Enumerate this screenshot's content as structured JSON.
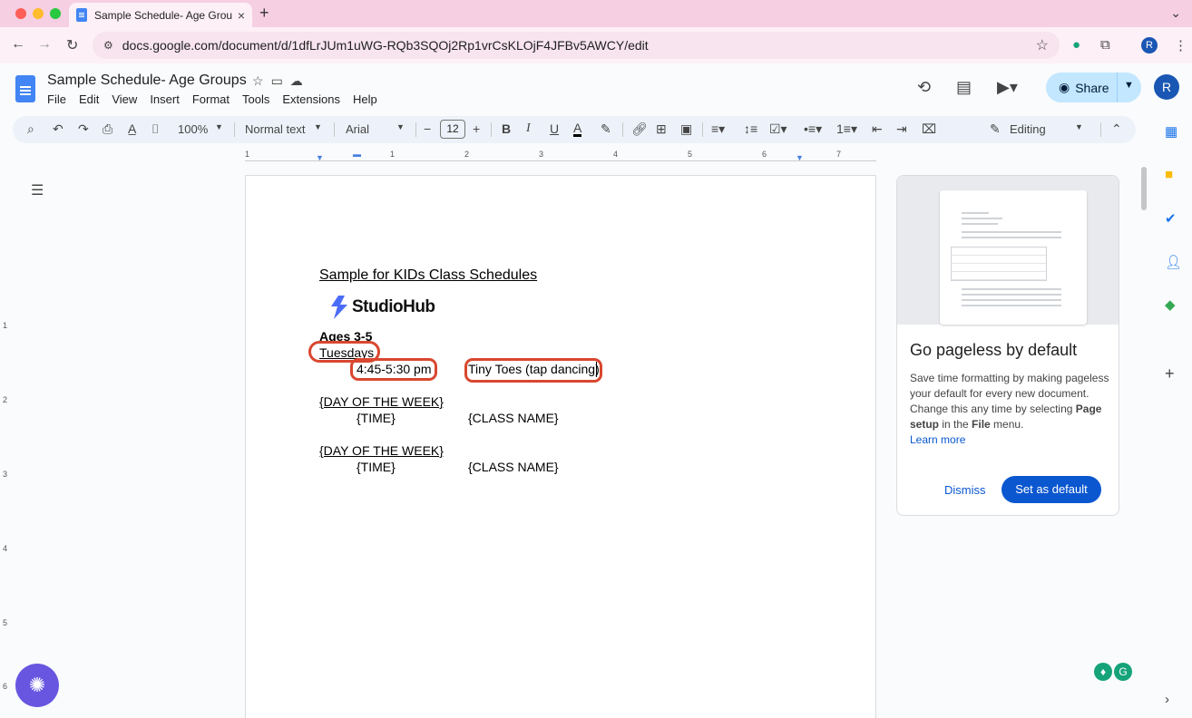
{
  "browser": {
    "tab_title": "Sample Schedule- Age Group",
    "tab_close": "×",
    "new_tab": "+",
    "url": "docs.google.com/document/d/1dfLrJUm1uWG-RQb3SQOj2Rp1vrCsKLOjF4JFBv5AWCY/edit",
    "profile_initial": "R"
  },
  "docs": {
    "title": "Sample Schedule- Age Groups",
    "menu": [
      "File",
      "Edit",
      "View",
      "Insert",
      "Format",
      "Tools",
      "Extensions",
      "Help"
    ],
    "share_label": "Share",
    "avatar_initial": "R"
  },
  "toolbar": {
    "zoom": "100%",
    "style": "Normal text",
    "font": "Arial",
    "font_size": "12",
    "mode": "Editing"
  },
  "ruler": {
    "h_numbers": [
      "1",
      "1",
      "2",
      "3",
      "4",
      "5",
      "6",
      "7"
    ],
    "v_numbers": [
      "1",
      "2",
      "3",
      "4",
      "5",
      "6"
    ]
  },
  "document": {
    "heading": "Sample for KIDs Class Schedules",
    "logo_text": "StudioHub",
    "age_group": "Ages 3-5",
    "rows": [
      {
        "day": "Tuesdays",
        "time": "4:45-5:30 pm",
        "class": "Tiny Toes (tap dancing)"
      },
      {
        "day": "{DAY OF THE WEEK}",
        "time": "{TIME}",
        "class": "{CLASS NAME}"
      },
      {
        "day": "{DAY OF THE WEEK}",
        "time": "{TIME}",
        "class": "{CLASS NAME}"
      }
    ]
  },
  "panel": {
    "title": "Go pageless by default",
    "body_1": "Save time formatting by making pageless your default for every new document. Change this any time by selecting ",
    "body_bold_1": "Page setup",
    "body_2": " in the ",
    "body_bold_2": "File",
    "body_3": " menu.",
    "link": "Learn more",
    "dismiss": "Dismiss",
    "set_default": "Set as default"
  },
  "colors": {
    "accent": "#0b57d0",
    "share_bg": "#c2e7ff",
    "annotation_red": "#d9472f",
    "tab_bar": "#f6cfe3"
  }
}
